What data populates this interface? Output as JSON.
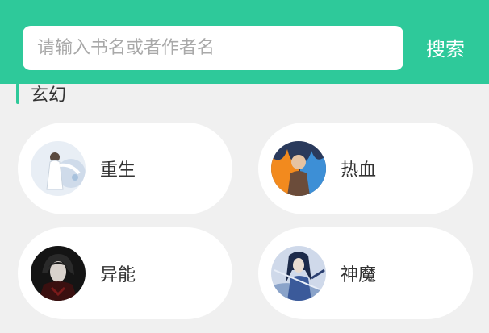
{
  "search": {
    "placeholder": "请输入书名或者作者名",
    "button_label": "搜索"
  },
  "section": {
    "title": "玄幻"
  },
  "categories": [
    {
      "label": "重生",
      "avatar_icon": "white-robed-figure-avatar"
    },
    {
      "label": "热血",
      "avatar_icon": "fire-warrior-avatar"
    },
    {
      "label": "异能",
      "avatar_icon": "dark-character-avatar"
    },
    {
      "label": "神魔",
      "avatar_icon": "blue-swordsman-avatar"
    }
  ],
  "colors": {
    "accent": "#2ec99a",
    "background": "#f0f0f0",
    "card": "#ffffff",
    "text": "#333333",
    "placeholder": "#a9a9a9"
  }
}
